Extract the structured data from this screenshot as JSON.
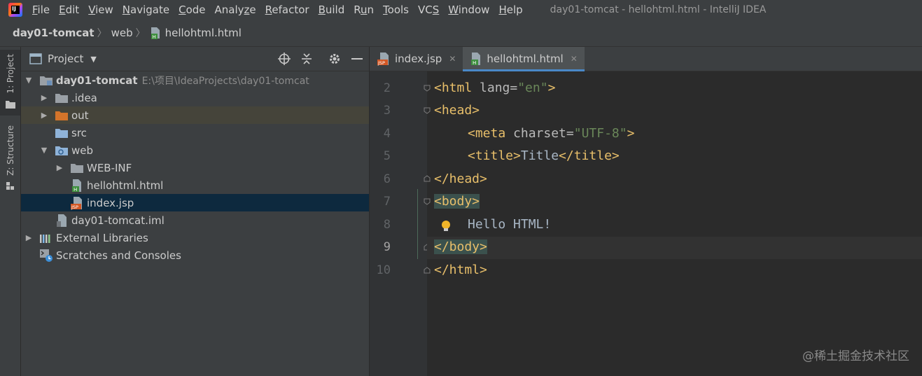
{
  "menubar": {
    "items": [
      {
        "label": "File",
        "u": "F",
        "rest": "ile"
      },
      {
        "label": "Edit",
        "u": "E",
        "rest": "dit"
      },
      {
        "label": "View",
        "u": "V",
        "rest": "iew"
      },
      {
        "label": "Navigate",
        "u": "N",
        "rest": "avigate"
      },
      {
        "label": "Code",
        "u": "C",
        "rest": "ode"
      },
      {
        "label": "Analyze",
        "u": "",
        "pre": "Analy",
        "u2": "z",
        "rest": "e"
      },
      {
        "label": "Refactor",
        "u": "R",
        "rest": "efactor"
      },
      {
        "label": "Build",
        "u": "B",
        "rest": "uild"
      },
      {
        "label": "Run",
        "u": "",
        "pre": "R",
        "u2": "u",
        "rest": "n"
      },
      {
        "label": "Tools",
        "u": "T",
        "rest": "ools"
      },
      {
        "label": "VCS",
        "u": "",
        "pre": "VC",
        "u2": "S",
        "rest": ""
      },
      {
        "label": "Window",
        "u": "W",
        "rest": "indow"
      },
      {
        "label": "Help",
        "u": "H",
        "rest": "elp"
      }
    ],
    "window_title": "day01-tomcat - hellohtml.html - IntelliJ IDEA",
    "logo_text": "IJ"
  },
  "breadcrumb": {
    "project": "day01-tomcat",
    "folder": "web",
    "file": "hellohtml.html"
  },
  "stripe": {
    "project_label": "1: Project",
    "structure_label": "Z: Structure"
  },
  "project_panel": {
    "title": "Project",
    "tree": [
      {
        "label": "day01-tomcat",
        "path": "E:\\项目\\IdeaProjects\\day01-tomcat"
      },
      {
        "label": ".idea"
      },
      {
        "label": "out"
      },
      {
        "label": "src"
      },
      {
        "label": "web"
      },
      {
        "label": "WEB-INF"
      },
      {
        "label": "hellohtml.html"
      },
      {
        "label": "index.jsp"
      },
      {
        "label": "day01-tomcat.iml"
      },
      {
        "label": "External Libraries"
      },
      {
        "label": "Scratches and Consoles"
      }
    ]
  },
  "editor": {
    "tabs": [
      {
        "label": "index.jsp",
        "active": false
      },
      {
        "label": "hellohtml.html",
        "active": true
      }
    ],
    "line_numbers": [
      "2",
      "3",
      "4",
      "5",
      "6",
      "7",
      "8",
      "9",
      "10"
    ],
    "current_line": "9",
    "code": {
      "l2_open": "<html",
      "l2_attr": " lang=",
      "l2_val": "\"en\"",
      "l2_close": ">",
      "l3": "<head>",
      "l4_open": "<meta",
      "l4_attr": " charset=",
      "l4_val": "\"UTF-8\"",
      "l4_close": ">",
      "l5_open": "<title>",
      "l5_text": "Title",
      "l5_close": "</title>",
      "l6": "</head>",
      "l7": "<body>",
      "l8": "Hello HTML!",
      "l9": "</body>",
      "l10": "</html>"
    }
  },
  "watermark": "@稀土掘金技术社区",
  "colors": {
    "tag": "#e8bf6a",
    "string": "#6a8759",
    "selection": "#0d293e",
    "tab_underline": "#4a88c7"
  }
}
